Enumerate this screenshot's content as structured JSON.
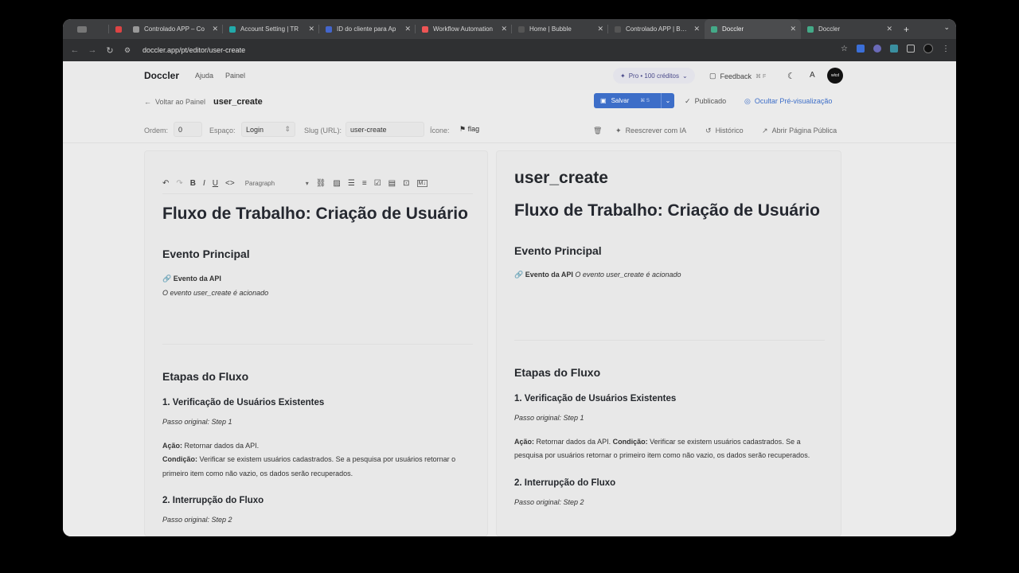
{
  "browser": {
    "tabs": [
      {
        "label": "",
        "icon": "window-icon",
        "color": "#777"
      },
      {
        "label": "",
        "icon": "gmail-icon",
        "color": "#d44"
      },
      {
        "label": "Controlado APP – Co",
        "icon": "gear-icon",
        "color": "#999"
      },
      {
        "label": "Account Setting | TR",
        "icon": "app-icon",
        "color": "#2aa"
      },
      {
        "label": "ID do cliente para Ap",
        "icon": "shield-icon",
        "color": "#46c"
      },
      {
        "label": "Workflow Automation",
        "icon": "n8n-icon",
        "color": "#e55"
      },
      {
        "label": "Home | Bubble",
        "icon": "bubble-icon",
        "color": "#333"
      },
      {
        "label": "Controlado APP | Bub",
        "icon": "bubble-icon",
        "color": "#333"
      },
      {
        "label": "Doccler",
        "icon": "doccler-icon",
        "color": "#4a8"
      },
      {
        "label": "Doccler",
        "icon": "doccler-icon",
        "color": "#4a8"
      }
    ],
    "new_tab": "+",
    "tab_menu": "⌄",
    "url": "doccler.app/pt/editor/user-create"
  },
  "header": {
    "logo": "Doccler",
    "nav": [
      "Ajuda",
      "Painel"
    ],
    "plan": "Pro • 100 créditos",
    "feedback": "Feedback",
    "feedback_kbd": "⌘ F",
    "avatar_text": "wlcd"
  },
  "toolbar": {
    "back": "Voltar ao Painel",
    "doc_title": "user_create",
    "save": "Salvar",
    "save_kbd": "⌘ S",
    "published": "Publicado",
    "hide_preview": "Ocultar Pré-visualização"
  },
  "meta": {
    "order_label": "Ordem:",
    "order_value": "0",
    "space_label": "Espaço:",
    "space_value": "Login",
    "slug_label": "Slug (URL):",
    "slug_value": "user-create",
    "icon_label": "Ícone:",
    "icon_value": "flag",
    "rewrite": "Reescrever com IA",
    "history": "Histórico",
    "open_public": "Abrir Página Pública"
  },
  "editor": {
    "format": "Paragraph",
    "h1": "Fluxo de Trabalho: Criação de Usuário",
    "h2_event": "Evento Principal",
    "event_label": "🔗 Evento da API",
    "event_text": "O evento user_create é acionado",
    "h2_steps": "Etapas do Fluxo",
    "step1_title": "1. Verificação de Usuários Existentes",
    "step1_orig": "Passo original: Step 1",
    "action_label": "Ação:",
    "action_text": " Retornar dados da API.",
    "cond_label": "Condição:",
    "cond_text": " Verificar se existem usuários cadastrados. Se a pesquisa por usuários retornar o primeiro item como não vazio, os dados serão recuperados.",
    "step2_title": "2. Interrupção do Fluxo",
    "step2_orig": "Passo original: Step 2"
  },
  "preview": {
    "title": "user_create",
    "h1": "Fluxo de Trabalho: Criação de Usuário",
    "h2_event": "Evento Principal",
    "event_label": "🔗 Evento da API",
    "event_text": " O evento user_create é acionado",
    "h2_steps": "Etapas do Fluxo",
    "step1_title": "1. Verificação de Usuários Existentes",
    "step1_orig": "Passo original: Step 1",
    "action_label": "Ação:",
    "action_text": " Retornar dados da API. ",
    "cond_label": "Condição:",
    "cond_text": " Verificar se existem usuários cadastrados. Se a pesquisa por usuários retornar o primeiro item como não vazio, os dados serão recuperados.",
    "step2_title": "2. Interrupção do Fluxo",
    "step2_orig": "Passo original: Step 2"
  }
}
